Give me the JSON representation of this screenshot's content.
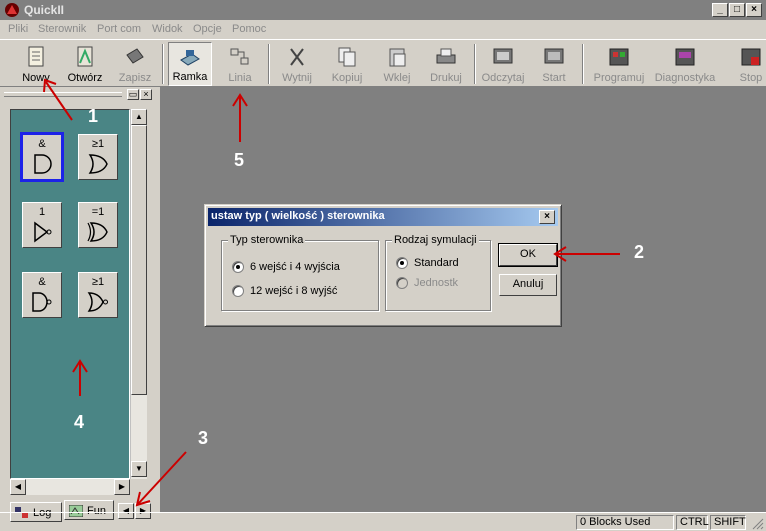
{
  "window": {
    "title": "QuickII"
  },
  "menu": [
    "Pliki",
    "Sterownik",
    "Port com",
    "Widok",
    "Opcje",
    "Pomoc"
  ],
  "toolbar": {
    "new": "Nowy",
    "open": "Otwórz",
    "save": "Zapisz",
    "frame": "Ramka",
    "line": "Linia",
    "cut": "Wytnij",
    "copy": "Kopiuj",
    "paste": "Wklej",
    "print": "Drukuj",
    "read": "Odczytaj",
    "start": "Start",
    "program": "Programuj",
    "diagnostics": "Diagnostyka",
    "stop": "Stop"
  },
  "palette": {
    "gates": [
      "&",
      "≥1",
      "1",
      "=1",
      "&",
      "≥1"
    ]
  },
  "tabs": {
    "log": "Log",
    "fun": "Fun"
  },
  "dialog": {
    "title": "ustaw typ ( wielkość ) sterownika",
    "group1": "Typ sterownika",
    "opt1": "6 wejść i 4 wyjścia",
    "opt2": "12 wejść i 8 wyjść",
    "group2": "Rodzaj symulacji",
    "sim1": "Standard",
    "sim2": "Jednostk",
    "ok": "OK",
    "cancel": "Anuluj"
  },
  "status": {
    "blocks": "0 Blocks Used",
    "ctrl": "CTRL",
    "shift": "SHIFT"
  },
  "annotations": [
    "1",
    "2",
    "3",
    "4",
    "5"
  ]
}
